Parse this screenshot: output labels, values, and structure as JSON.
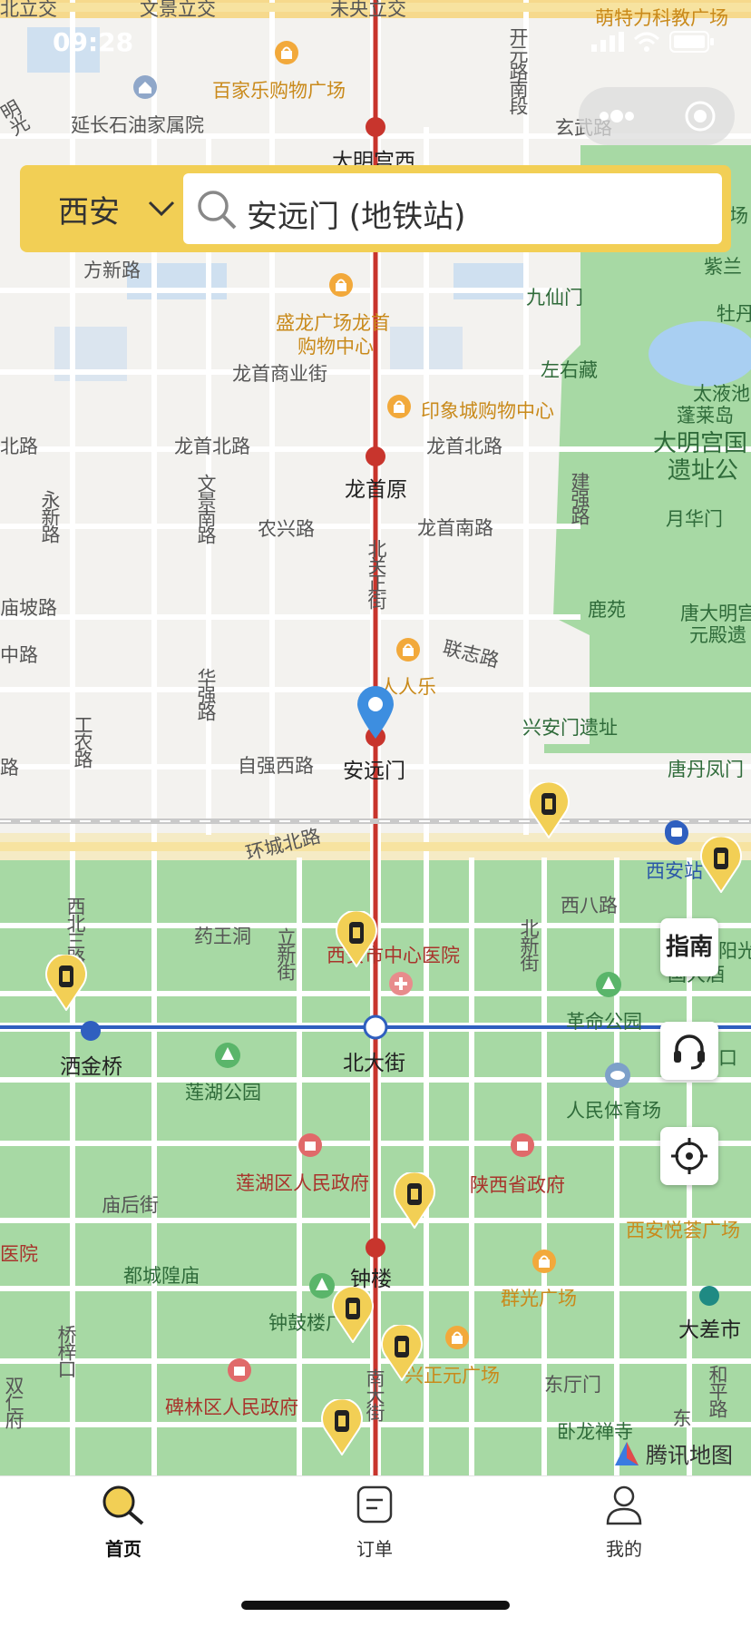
{
  "status_bar": {
    "time": "09:28"
  },
  "search": {
    "city": "西安",
    "query": "安远门 (地铁站)"
  },
  "map": {
    "poi_orange": [
      "百家乐购物广场",
      "盛龙广场龙首",
      "购物中心",
      "印象城购物中心",
      "人人乐",
      "群光广场",
      "兴正元广场",
      "西安悦荟广场",
      "萌特力科教广场"
    ],
    "poi_red": [
      "西安市中心医院",
      "莲湖区人民政府",
      "陕西省政府",
      "碑林区人民政府"
    ],
    "roads": [
      "延长石油家属院",
      "方新路",
      "龙首商业街",
      "龙首北路",
      "龙首北路",
      "北路",
      "农兴路",
      "龙首南路",
      "联志路",
      "自强西路",
      "环城北路",
      "药王洞",
      "西八路",
      "庙后街",
      "东厅门",
      "玄武路",
      "庙坡路",
      "中路",
      "路",
      "未央立交",
      "文景立交",
      "北立交"
    ],
    "metro": [
      "大明宫西",
      "龙首原",
      "安远门",
      "北大街",
      "钟楼",
      "洒金桥",
      "西安站",
      "大差市"
    ],
    "parks": [
      "九仙门",
      "左右藏",
      "月华门",
      "鹿苑",
      "兴安门遗址",
      "唐丹凤门",
      "莲湖公园",
      "都城隍庙",
      "钟鼓楼广场",
      "卧龙禅寺",
      "革命公园",
      "人民体育场",
      "紫兰",
      "牡丹",
      "太液池",
      "蓬莱岛",
      "唐大明宫",
      "元殿遗",
      "阳光",
      "国大酒",
      "口",
      "场"
    ],
    "big_park": [
      "大明宫国",
      "遗址公"
    ],
    "vertical_roads": [
      "开元路南段",
      "文景南路",
      "北关正街",
      "永新路",
      "华强路",
      "工农路",
      "建强路",
      "西北三路",
      "立新街",
      "北新街",
      "桥梓口",
      "南大街",
      "和平路",
      "东",
      "双仁府",
      "明光"
    ],
    "hospital_prefix": "医院",
    "watermark": "腾讯地图",
    "guide_label": "指南"
  },
  "nav": {
    "home_label": "首页",
    "orders_label": "订单",
    "mine_label": "我的"
  },
  "colors": {
    "accent": "#f2cf55",
    "metro_red": "#c8352d",
    "metro_blue": "#2f5fbf",
    "park_green": "#a7d9a4"
  }
}
